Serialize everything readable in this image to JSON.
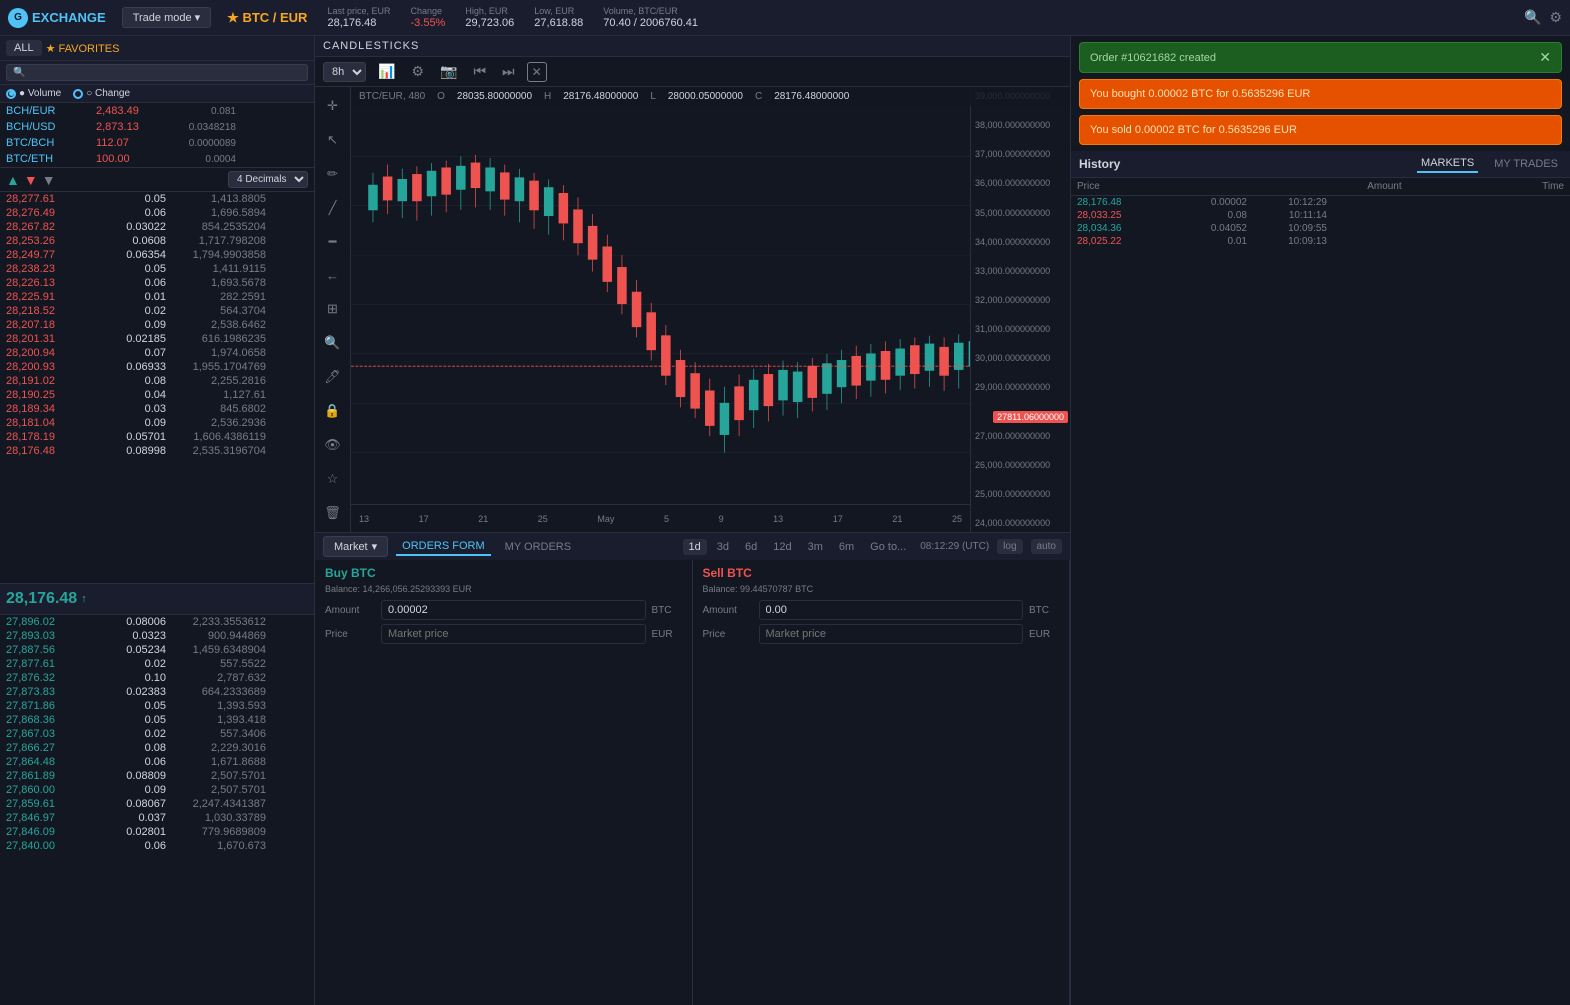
{
  "header": {
    "logo_text": "EXCHANGE",
    "logo_icon": "G",
    "trade_mode_label": "Trade mode ▾",
    "pair_name": "★ BTC / EUR",
    "last_price_label": "Last price, EUR",
    "last_price_value": "28,176.48",
    "change_label": "Change",
    "change_value": "-3.55%",
    "high_label": "High, EUR",
    "high_value": "29,723.06",
    "low_label": "Low, EUR",
    "low_value": "27,618.88",
    "volume_label": "Volume, BTC/EUR",
    "volume_value": "70.40 / 2006760.41"
  },
  "sidebar": {
    "tab_all": "ALL",
    "tab_favorites": "★ FAVORITES",
    "volume_label": "● Volume",
    "change_label": "○ Change",
    "coins": [
      {
        "name": "BCH/EUR",
        "price": "2,483.49",
        "vol": "0.081"
      },
      {
        "name": "BCH/USD",
        "price": "2,873.13",
        "vol": "0.0348218"
      },
      {
        "name": "BTC/BCH",
        "price": "112.07",
        "vol": "0.0000089"
      },
      {
        "name": "BTC/ETH",
        "price": "100.00",
        "vol": "0.0004"
      }
    ],
    "decimals_label": "4 Decimals",
    "asks": [
      {
        "price": "28,277.61",
        "amount": "0.05",
        "total": "1,413.8805"
      },
      {
        "price": "28,276.49",
        "amount": "0.06",
        "total": "1,696.5894"
      },
      {
        "price": "28,267.82",
        "amount": "0.03022",
        "total": "854.2535204"
      },
      {
        "price": "28,253.26",
        "amount": "0.0608",
        "total": "1,717.798208"
      },
      {
        "price": "28,249.77",
        "amount": "0.06354",
        "total": "1,794.9903858"
      },
      {
        "price": "28,238.23",
        "amount": "0.05",
        "total": "1,411.9115"
      },
      {
        "price": "28,226.13",
        "amount": "0.06",
        "total": "1,693.5678"
      },
      {
        "price": "28,225.91",
        "amount": "0.01",
        "total": "282.2591"
      },
      {
        "price": "28,218.52",
        "amount": "0.02",
        "total": "564.3704"
      },
      {
        "price": "28,207.18",
        "amount": "0.09",
        "total": "2,538.6462"
      },
      {
        "price": "28,201.31",
        "amount": "0.02185",
        "total": "616.1986235"
      },
      {
        "price": "28,200.94",
        "amount": "0.07",
        "total": "1,974.0658"
      },
      {
        "price": "28,200.93",
        "amount": "0.06933",
        "total": "1,955.1704769"
      },
      {
        "price": "28,191.02",
        "amount": "0.08",
        "total": "2,255.2816"
      },
      {
        "price": "28,190.25",
        "amount": "0.04",
        "total": "1,127.61"
      },
      {
        "price": "28,189.34",
        "amount": "0.03",
        "total": "845.6802"
      },
      {
        "price": "28,181.04",
        "amount": "0.09",
        "total": "2,536.2936"
      },
      {
        "price": "28,178.19",
        "amount": "0.05701",
        "total": "1,606.4386119"
      },
      {
        "price": "28,176.48",
        "amount": "0.08998",
        "total": "2,535.3196704"
      }
    ],
    "mid_price": "28,176.48",
    "mid_arrow": "↑",
    "bids": [
      {
        "price": "27,896.02",
        "amount": "0.08006",
        "total": "2,233.3553612"
      },
      {
        "price": "27,893.03",
        "amount": "0.0323",
        "total": "900.944869"
      },
      {
        "price": "27,887.56",
        "amount": "0.05234",
        "total": "1,459.6348904"
      },
      {
        "price": "27,877.61",
        "amount": "0.02",
        "total": "557.5522"
      },
      {
        "price": "27,876.32",
        "amount": "0.10",
        "total": "2,787.632"
      },
      {
        "price": "27,873.83",
        "amount": "0.02383",
        "total": "664.2333689"
      },
      {
        "price": "27,871.86",
        "amount": "0.05",
        "total": "1,393.593"
      },
      {
        "price": "27,868.36",
        "amount": "0.05",
        "total": "1,393.418"
      },
      {
        "price": "27,867.03",
        "amount": "0.02",
        "total": "557.3406"
      },
      {
        "price": "27,866.27",
        "amount": "0.08",
        "total": "2,229.3016"
      },
      {
        "price": "27,864.48",
        "amount": "0.06",
        "total": "1,671.8688"
      },
      {
        "price": "27,861.89",
        "amount": "0.08809",
        "total": "2,507.5701"
      },
      {
        "price": "27,860.00",
        "amount": "0.09",
        "total": "2,507.5701"
      },
      {
        "price": "27,859.61",
        "amount": "0.08067",
        "total": "2,247.4341387"
      },
      {
        "price": "27,846.97",
        "amount": "0.037",
        "total": "1,030.33789"
      },
      {
        "price": "27,846.09",
        "amount": "0.02801",
        "total": "779.9689809"
      },
      {
        "price": "27,840.00",
        "amount": "0.06",
        "total": "1,670.673"
      }
    ]
  },
  "chart": {
    "title": "CANDLESTICKS",
    "pair_label": "BTC/EUR, 480",
    "timeframe": "8h",
    "open": "28035.80000000",
    "high": "28176.48000000",
    "low": "28000.05000000",
    "close": "28176.48000000",
    "timeframes": [
      "1d",
      "3d",
      "6d",
      "12d",
      "3m",
      "6m",
      "Go to..."
    ],
    "active_timeframe": "1d",
    "time_axis": [
      "13",
      "17",
      "21",
      "25",
      "May",
      "5",
      "9",
      "13",
      "17",
      "21",
      "25"
    ],
    "price_scale": [
      "39000.00",
      "38000.00",
      "37000.00",
      "36000.00",
      "35000.00",
      "34000.00",
      "33000.00",
      "32000.00",
      "31000.00",
      "30000.00",
      "29000.00",
      "28000.00",
      "27000.00",
      "26000.00",
      "25000.00",
      "24000.00"
    ],
    "current_price_badge": "27811.06000000",
    "utc_time": "08:12:29 (UTC)",
    "scale_log": "log",
    "scale_auto": "auto"
  },
  "notifications": {
    "order_created": "Order #10621682 created",
    "bought_msg": "You bought 0.00002 BTC for 0.5635296 EUR",
    "sold_msg": "You sold 0.00002 BTC for 0.5635296 EUR"
  },
  "trade_form": {
    "market_label": "Market",
    "orders_form_tab": "ORDERS FORM",
    "my_orders_tab": "MY ORDERS",
    "buy_title": "Buy BTC",
    "buy_balance_label": "Balance:",
    "buy_balance_value": "14,266,056.25293393 EUR",
    "sell_title": "Sell BTC",
    "sell_balance_label": "Balance:",
    "sell_balance_value": "99.44570787 BTC",
    "amount_label": "Amount",
    "buy_amount_value": "0.00002",
    "buy_amount_unit": "BTC",
    "sell_amount_value": "0.00",
    "sell_amount_unit": "BTC",
    "price_label": "Price",
    "buy_price_placeholder": "Market price",
    "buy_price_unit": "EUR",
    "sell_price_placeholder": "Market price",
    "sell_price_unit": "EUR"
  },
  "history": {
    "title": "History",
    "markets_tab": "MARKETS",
    "my_trades_tab": "MY TRADES",
    "rows": [
      {
        "price": "28,176.48",
        "price_type": "green",
        "amount": "0.00002",
        "time": "10:12:29"
      },
      {
        "price": "28,033.25",
        "price_type": "red",
        "amount": "0.08",
        "time": "10:11:14"
      },
      {
        "price": "28,034.36",
        "price_type": "green",
        "amount": "0.04052",
        "time": "10:09:55"
      },
      {
        "price": "28,025.22",
        "price_type": "red",
        "amount": "0.01",
        "time": "10:09:13"
      }
    ]
  }
}
